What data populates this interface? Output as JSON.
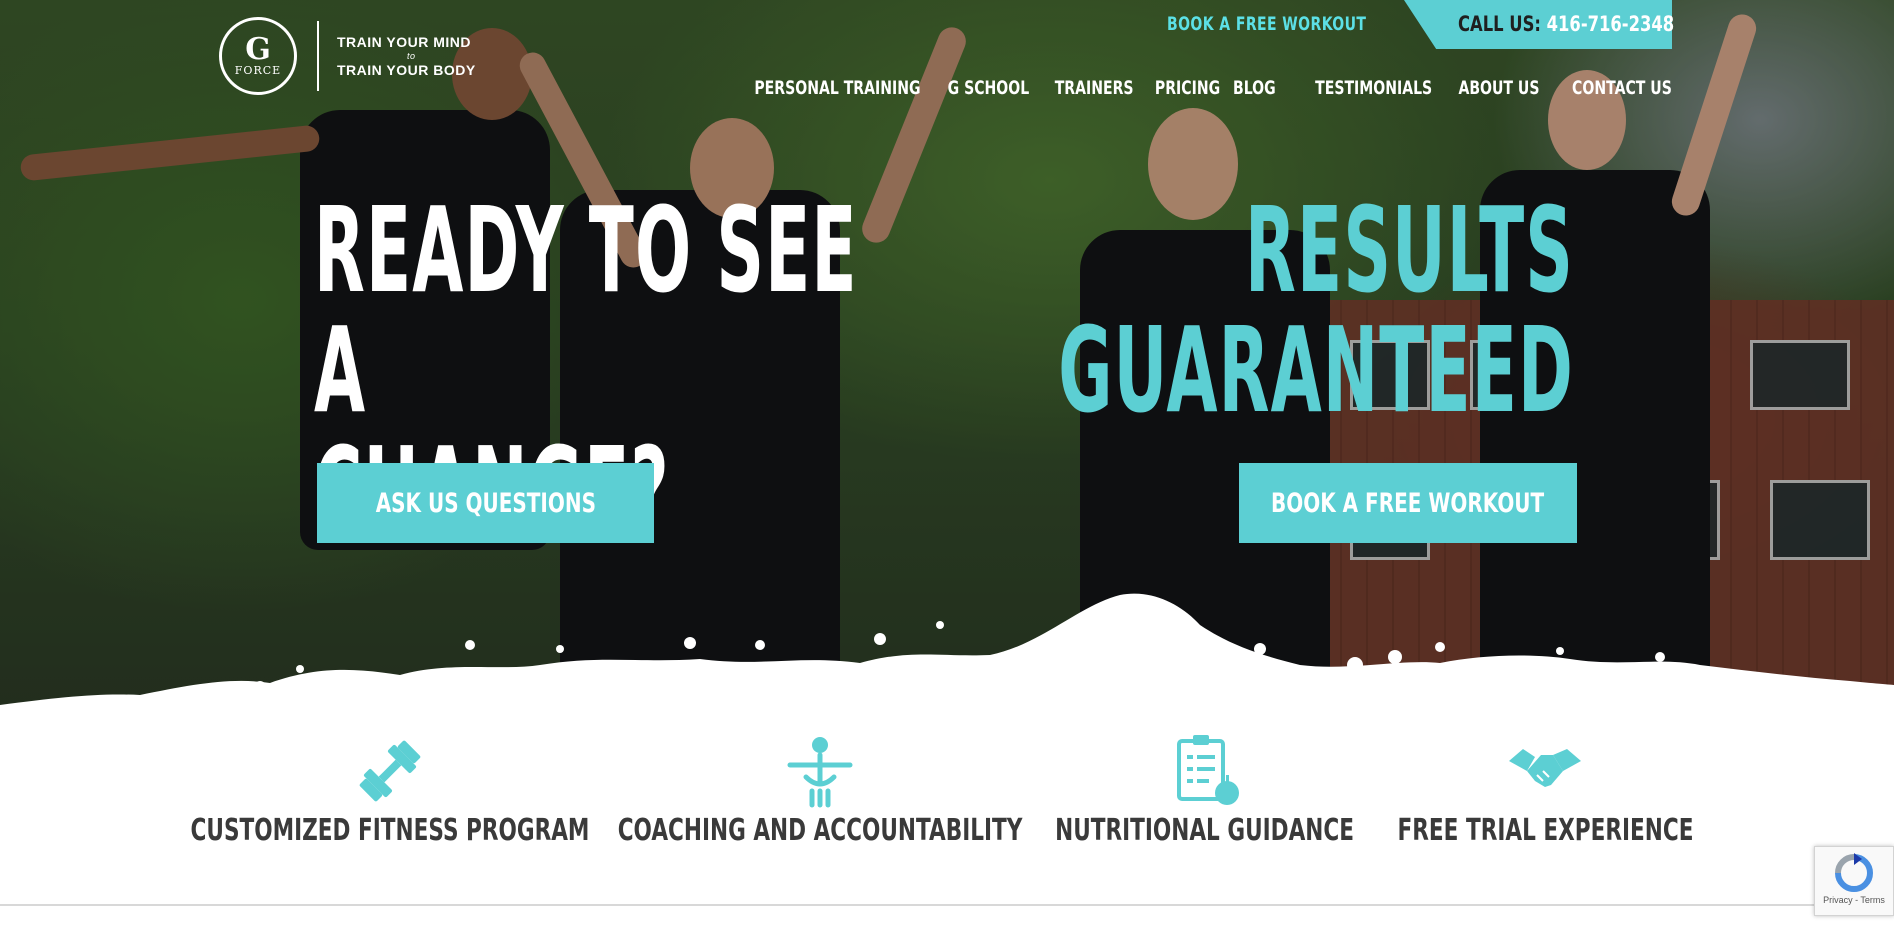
{
  "brand": {
    "logo_letter": "G",
    "logo_word": "FORCE",
    "tagline_line1": "TRAIN YOUR MIND",
    "tagline_to": "to",
    "tagline_line2": "TRAIN YOUR BODY"
  },
  "topbar": {
    "book_link": "BOOK A FREE WORKOUT",
    "call_label": "CALL US:",
    "phone": "416-716-2348"
  },
  "nav": {
    "items": [
      {
        "label": "PERSONAL TRAINING"
      },
      {
        "label": "G SCHOOL"
      },
      {
        "label": "TRAINERS"
      },
      {
        "label": "PRICING"
      },
      {
        "label": "BLOG"
      },
      {
        "label": "TESTIMONIALS"
      },
      {
        "label": "ABOUT US"
      },
      {
        "label": "CONTACT US"
      }
    ]
  },
  "hero": {
    "headline_left_line1": "READY TO SEE A",
    "headline_left_line2": "CHANGE?",
    "headline_right_line1": "RESULTS",
    "headline_right_line2": "GUARANTEED",
    "btn_ask": "ASK US QUESTIONS",
    "btn_book": "BOOK A FREE WORKOUT"
  },
  "features": [
    {
      "label": "CUSTOMIZED FITNESS PROGRAM",
      "icon": "dumbbell-icon"
    },
    {
      "label": "COACHING AND ACCOUNTABILITY",
      "icon": "coach-icon"
    },
    {
      "label": "NUTRITIONAL GUIDANCE",
      "icon": "clipboard-apple-icon"
    },
    {
      "label": "FREE TRIAL EXPERIENCE",
      "icon": "handshake-icon"
    }
  ],
  "recaptcha": {
    "text": "Privacy - Terms"
  },
  "colors": {
    "accent": "#5ccfd3",
    "accent_bright": "#5ce0e6",
    "text_dark": "#3a3a3a"
  }
}
